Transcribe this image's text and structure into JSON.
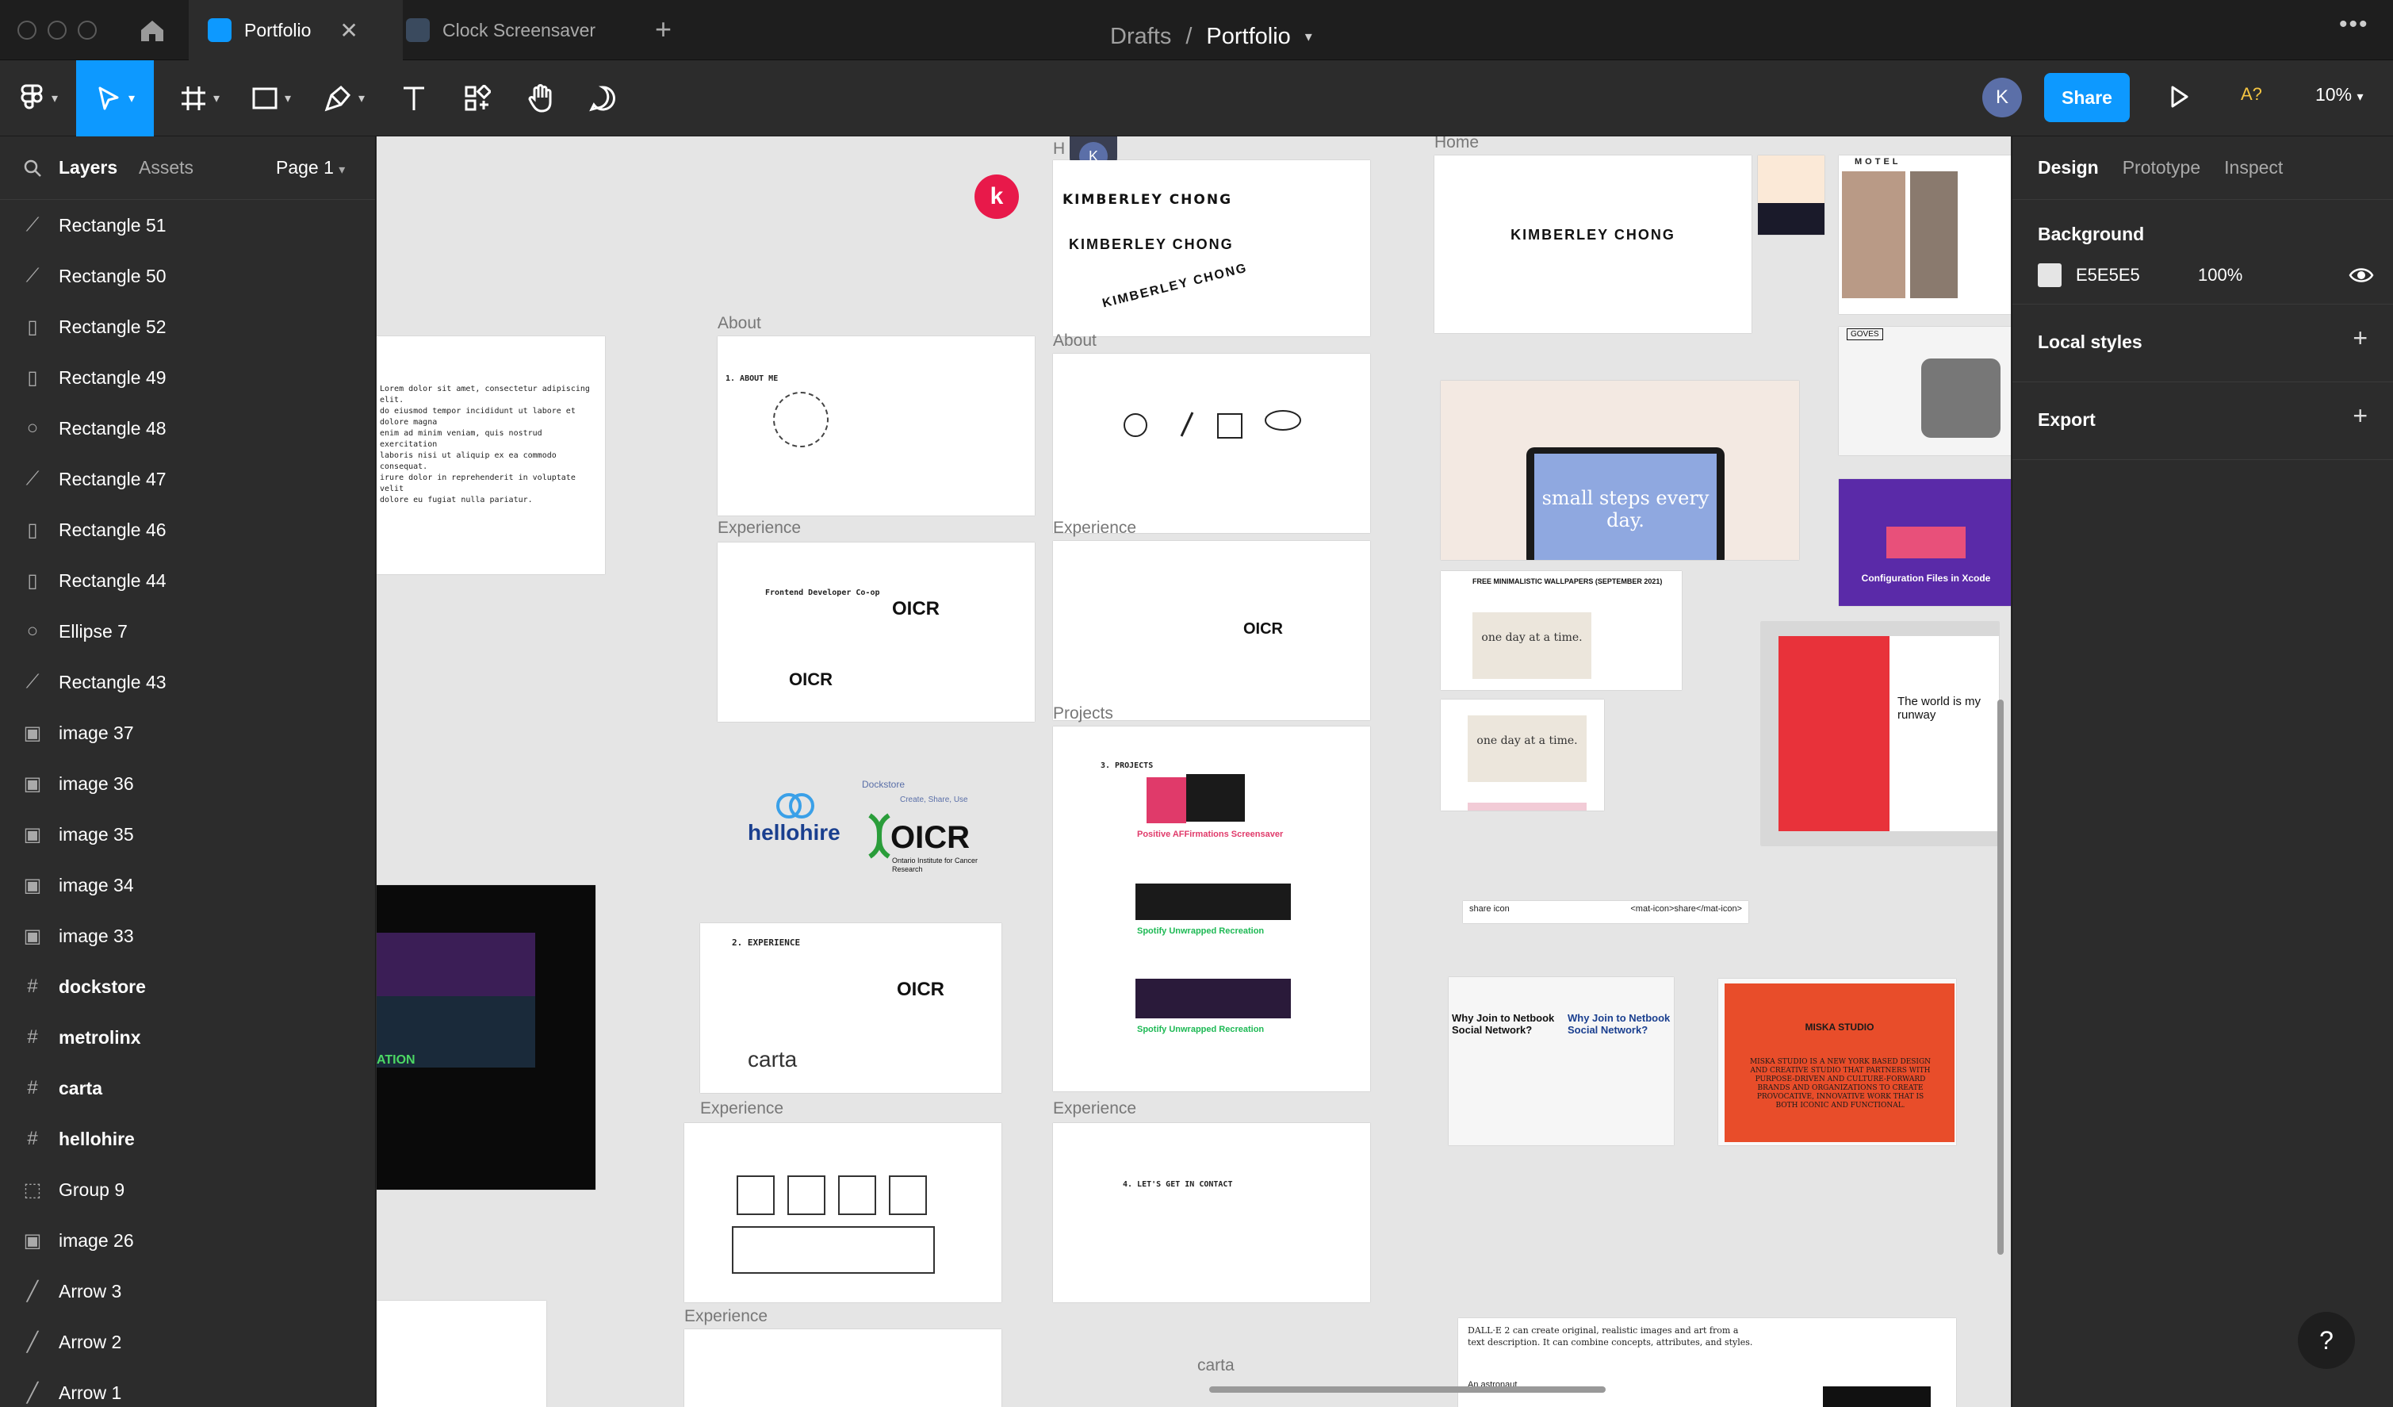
{
  "tabs": {
    "active": "Portfolio",
    "inactive": "Clock Screensaver"
  },
  "toolbar": {
    "breadcrumb_parent": "Drafts",
    "breadcrumb_separator": "/",
    "breadcrumb_current": "Portfolio",
    "avatar_initial": "K",
    "share_label": "Share",
    "a_label": "A?",
    "zoom": "10%"
  },
  "left_panel": {
    "tab_layers": "Layers",
    "tab_assets": "Assets",
    "page": "Page 1",
    "layers": [
      {
        "icon": "path-icon",
        "name": "Rectangle 51"
      },
      {
        "icon": "path-icon",
        "name": "Rectangle 50"
      },
      {
        "icon": "rect-icon",
        "name": "Rectangle 52"
      },
      {
        "icon": "rect-icon",
        "name": "Rectangle 49"
      },
      {
        "icon": "ellipse-icon",
        "name": "Rectangle 48"
      },
      {
        "icon": "path-icon",
        "name": "Rectangle 47"
      },
      {
        "icon": "rect-icon",
        "name": "Rectangle 46"
      },
      {
        "icon": "rect-icon",
        "name": "Rectangle 44"
      },
      {
        "icon": "ellipse-icon",
        "name": "Ellipse 7"
      },
      {
        "icon": "path-icon",
        "name": "Rectangle 43"
      },
      {
        "icon": "image-icon",
        "name": "image 37"
      },
      {
        "icon": "image-icon",
        "name": "image 36"
      },
      {
        "icon": "image-icon",
        "name": "image 35"
      },
      {
        "icon": "image-icon",
        "name": "image 34"
      },
      {
        "icon": "image-icon",
        "name": "image 33"
      },
      {
        "icon": "frame-icon",
        "name": "dockstore"
      },
      {
        "icon": "frame-icon",
        "name": "metrolinx"
      },
      {
        "icon": "frame-icon",
        "name": "carta"
      },
      {
        "icon": "frame-icon",
        "name": "hellohire"
      },
      {
        "icon": "group-icon",
        "name": "Group 9"
      },
      {
        "icon": "image-icon",
        "name": "image 26"
      },
      {
        "icon": "line-icon",
        "name": "Arrow 3"
      },
      {
        "icon": "line-icon",
        "name": "Arrow 2"
      },
      {
        "icon": "line-icon",
        "name": "Arrow 1"
      }
    ]
  },
  "right_panel": {
    "tab_design": "Design",
    "tab_prototype": "Prototype",
    "tab_inspect": "Inspect",
    "background_label": "Background",
    "background_color": "E5E5E5",
    "background_opacity": "100%",
    "local_styles": "Local styles",
    "export": "Export"
  },
  "canvas": {
    "background": "#e5e5e5",
    "labels": {
      "home": "Home",
      "home_cut": "H",
      "about_1": "About",
      "about_2": "About",
      "experience_1": "Experience",
      "experience_2": "Experience",
      "experience_3": "Experience",
      "experience_4": "Experience",
      "experience_5": "Experience",
      "projects": "Projects",
      "carta": "carta"
    },
    "kimberley": "KIMBERLEY CHONG",
    "hellohire": "hellohire",
    "oicr": "OICR",
    "oicr_sub": "Ontario Institute for Cancer Research",
    "dockstore": "Dockstore",
    "dockstore_sub": "Create, Share, Use",
    "carta_logo": "carta",
    "experience_heading": "2. EXPERIENCE",
    "about_heading": "1. ABOUT ME",
    "projects_heading": "3. PROJECTS",
    "contact_heading": "4. LET'S GET IN CONTACT",
    "frontend_dev": "Frontend Developer Co-op",
    "positive_affirmations": "Positive AFFirmations Screensaver",
    "spotify": "Spotify Unwrapped Recreation",
    "small_steps": "small steps every day.",
    "one_day": "one day at a time.",
    "wallpapers": "FREE MINIMALISTIC WALLPAPERS (SEPTEMBER 2021)",
    "config_files": "Configuration Files in Xcode",
    "world_runway": "The world is my runway",
    "share_icon": "share icon",
    "mat_icon": "<mat-icon>share</mat-icon>",
    "netbook_q": "Why Join to Netbook Social Network?",
    "miska": "MISKA STUDIO",
    "miska_body": "MISKA STUDIO IS A NEW YORK BASED DESIGN AND CREATIVE STUDIO THAT PARTNERS WITH PURPOSE-DRIVEN AND CULTURE-FORWARD BRANDS AND ORGANIZATIONS TO CREATE PROVOCATIVE, INNOVATIVE WORK THAT IS BOTH ICONIC AND FUNCTIONAL.",
    "dalle": "DALL·E 2 can create original, realistic images and art from a text description. It can combine concepts, attributes, and styles.",
    "astronaut": "An astronaut",
    "ation": "ATION",
    "motel": "MOTEL",
    "goves": "GOVES"
  }
}
